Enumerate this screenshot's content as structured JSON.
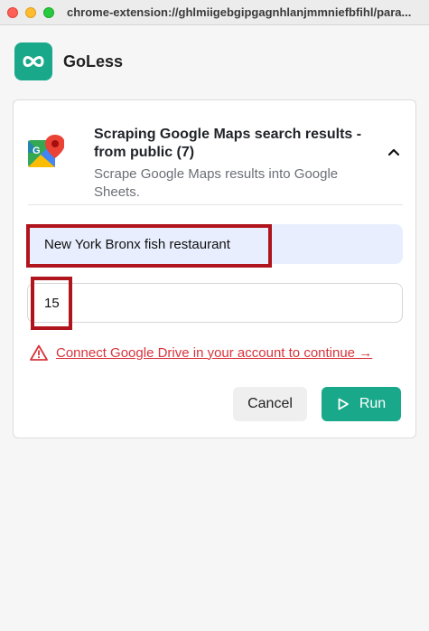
{
  "window": {
    "url": "chrome-extension://ghlmiigebgipgagnhlanjmmniefbfihl/para..."
  },
  "app": {
    "name": "GoLess"
  },
  "card": {
    "title": "Scraping Google Maps search results - from public (7)",
    "subtitle": "Scrape Google Maps results into Google Sheets."
  },
  "form": {
    "query_value": "New York Bronx fish restaurant",
    "count_value": "15"
  },
  "warning": {
    "text": "Connect Google Drive in your account to continue →"
  },
  "buttons": {
    "cancel_label": "Cancel",
    "run_label": "Run"
  },
  "colors": {
    "accent": "#1aa88a",
    "warning": "#d8343c",
    "highlight": "#b0141c"
  },
  "icons": {
    "logo": "infinity-icon",
    "card": "google-maps-icon",
    "collapse": "chevron-up-icon",
    "warning": "warning-triangle-icon",
    "run": "play-icon"
  }
}
